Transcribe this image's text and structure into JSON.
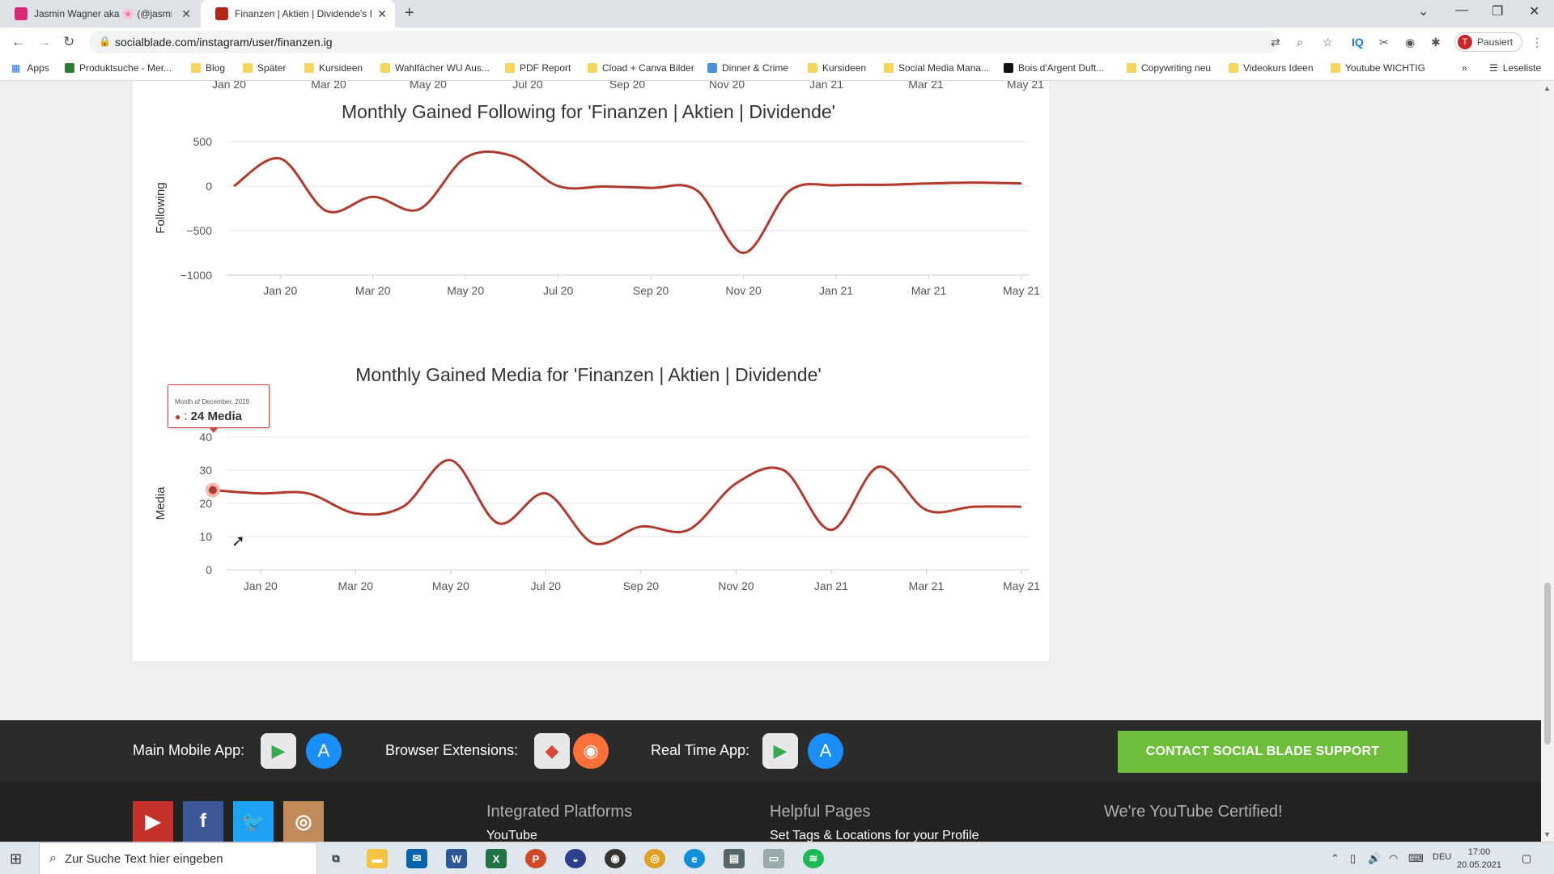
{
  "browser": {
    "tabs": [
      {
        "title": "Jasmin Wagner aka 🌸 (@jasmin",
        "favicon_color": "#d62976"
      },
      {
        "title": "Finanzen | Aktien | Dividende's In",
        "favicon_color": "#b0281a"
      }
    ],
    "url": "socialblade.com/instagram/user/finanzen.ig",
    "profile_label": "Pausiert",
    "profile_initial": "T",
    "apps_label": "Apps",
    "reading_list": "Leseliste",
    "bookmarks": [
      "Produktsuche - Mer...",
      "Blog",
      "Später",
      "Kursideen",
      "Wahlfächer WU Aus...",
      "PDF Report",
      "Cload + Canva Bilder",
      "Dinner & Crime",
      "Kursideen",
      "Social Media Mana...",
      "Bois d'Argent Duft...",
      "Copywriting neu",
      "Videokurs Ideen",
      "Youtube WICHTIG"
    ]
  },
  "chart_data": [
    {
      "type": "line",
      "title": "Monthly Gained Following for 'Finanzen | Aktien | Dividende'",
      "ylabel": "Following",
      "x": [
        "Dec 19",
        "Jan 20",
        "Feb 20",
        "Mar 20",
        "Apr 20",
        "May 20",
        "Jun 20",
        "Jul 20",
        "Aug 20",
        "Sep 20",
        "Oct 20",
        "Nov 20",
        "Dec 20",
        "Jan 21",
        "Feb 21",
        "Mar 21",
        "Apr 21",
        "May 21"
      ],
      "values": [
        0,
        310,
        -280,
        -120,
        -260,
        320,
        340,
        0,
        -5,
        -20,
        -50,
        -750,
        -50,
        10,
        15,
        30,
        40,
        30
      ],
      "ylim": [
        -1000,
        500
      ],
      "yticks": [
        "500",
        "0",
        "−500",
        "−1000"
      ],
      "xticks": [
        "Jan 20",
        "Mar 20",
        "May 20",
        "Jul 20",
        "Sep 20",
        "Nov 20",
        "Jan 21",
        "Mar 21",
        "May 21"
      ],
      "color": "#b03a2e"
    },
    {
      "type": "line",
      "title": "Monthly Gained Media for 'Finanzen | Aktien | Dividende'",
      "ylabel": "Media",
      "x": [
        "Dec 19",
        "Jan 20",
        "Feb 20",
        "Mar 20",
        "Apr 20",
        "May 20",
        "Jun 20",
        "Jul 20",
        "Aug 20",
        "Sep 20",
        "Oct 20",
        "Nov 20",
        "Dec 20",
        "Jan 21",
        "Feb 21",
        "Mar 21",
        "Apr 21",
        "May 21"
      ],
      "values": [
        24,
        23,
        23,
        17,
        19,
        33,
        14,
        23,
        8,
        13,
        12,
        26,
        30,
        12,
        31,
        18,
        19,
        19
      ],
      "ylim": [
        0,
        40
      ],
      "yticks": [
        "40",
        "30",
        "20",
        "10",
        "0"
      ],
      "xticks": [
        "Jan 20",
        "Mar 20",
        "May 20",
        "Jul 20",
        "Sep 20",
        "Nov 20",
        "Jan 21",
        "Mar 21",
        "May 21"
      ],
      "color": "#b03a2e"
    }
  ],
  "top_axis_labels": [
    "Jan 20",
    "Mar 20",
    "May 20",
    "Jul 20",
    "Sep 20",
    "Nov 20",
    "Jan 21",
    "Mar 21",
    "May 21"
  ],
  "tooltip": {
    "subtitle": "Month of December, 2019",
    "separator": ":",
    "value": "24 Media"
  },
  "footer": {
    "main_app_label": "Main Mobile App:",
    "browser_ext_label": "Browser Extensions:",
    "realtime_label": "Real Time App:",
    "contact_button": "CONTACT SOCIAL BLADE SUPPORT",
    "integrated_title": "Integrated Platforms",
    "integrated_first": "YouTube",
    "helpful_title": "Helpful Pages",
    "helpful_first": "Set Tags & Locations for your Profile",
    "certified_title": "We're YouTube Certified!"
  },
  "taskbar": {
    "search_placeholder": "Zur Suche Text hier eingeben",
    "language": "DEU",
    "time": "17:00",
    "date": "20.05.2021"
  }
}
